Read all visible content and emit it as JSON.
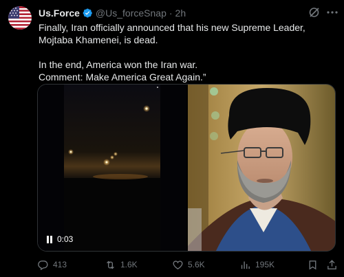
{
  "author": {
    "display_name": "Us.Force",
    "handle": "@Us_forceSnap",
    "separator": "·",
    "time": "2h",
    "avatar_icon": "us-flag-avatar",
    "verified_color": "#1d9bf0"
  },
  "tweet": {
    "line1": "Finally, Iran officially announced that his new Supreme Leader, Mojtaba Khamenei, is dead.",
    "line2": "In the end, America won the Iran war.",
    "line3": "Comment: Make America Great Again.”"
  },
  "media": {
    "video_time": "0:03",
    "video_icon": "pause-icon"
  },
  "actions": {
    "replies": "413",
    "reposts": "1.6K",
    "likes": "5.6K",
    "views": "195K"
  },
  "colors": {
    "background": "#000000",
    "text": "#e7e9ea",
    "muted": "#71767b",
    "accent": "#1d9bf0"
  }
}
